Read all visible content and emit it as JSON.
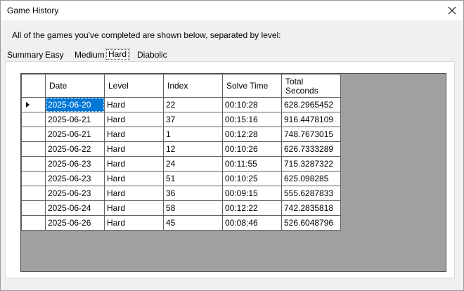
{
  "window": {
    "title": "Game History"
  },
  "description": "All of the games you've completed are shown below, separated by level:",
  "tabs": [
    {
      "label": "Summary"
    },
    {
      "label": "Easy"
    },
    {
      "label": "Medium"
    },
    {
      "label": "Hard"
    },
    {
      "label": "Diabolic"
    }
  ],
  "active_tab": "Hard",
  "grid": {
    "columns": [
      "Date",
      "Level",
      "Index",
      "Solve Time",
      "Total\nSeconds"
    ],
    "rows": [
      [
        "2025-06-20",
        "Hard",
        "22",
        "00:10:28",
        "628.2965452"
      ],
      [
        "2025-06-21",
        "Hard",
        "37",
        "00:15:16",
        "916.4478109"
      ],
      [
        "2025-06-21",
        "Hard",
        "1",
        "00:12:28",
        "748.7673015"
      ],
      [
        "2025-06-22",
        "Hard",
        "12",
        "00:10:26",
        "626.7333289"
      ],
      [
        "2025-06-23",
        "Hard",
        "24",
        "00:11:55",
        "715.3287322"
      ],
      [
        "2025-06-23",
        "Hard",
        "51",
        "00:10:25",
        "625.098285"
      ],
      [
        "2025-06-23",
        "Hard",
        "36",
        "00:09:15",
        "555.6287833"
      ],
      [
        "2025-06-24",
        "Hard",
        "58",
        "00:12:22",
        "742.2835818"
      ],
      [
        "2025-06-26",
        "Hard",
        "45",
        "00:08:46",
        "526.6048796"
      ]
    ]
  },
  "colors": {
    "selection": "#0078d7",
    "grid_background": "#a0a0a0"
  }
}
